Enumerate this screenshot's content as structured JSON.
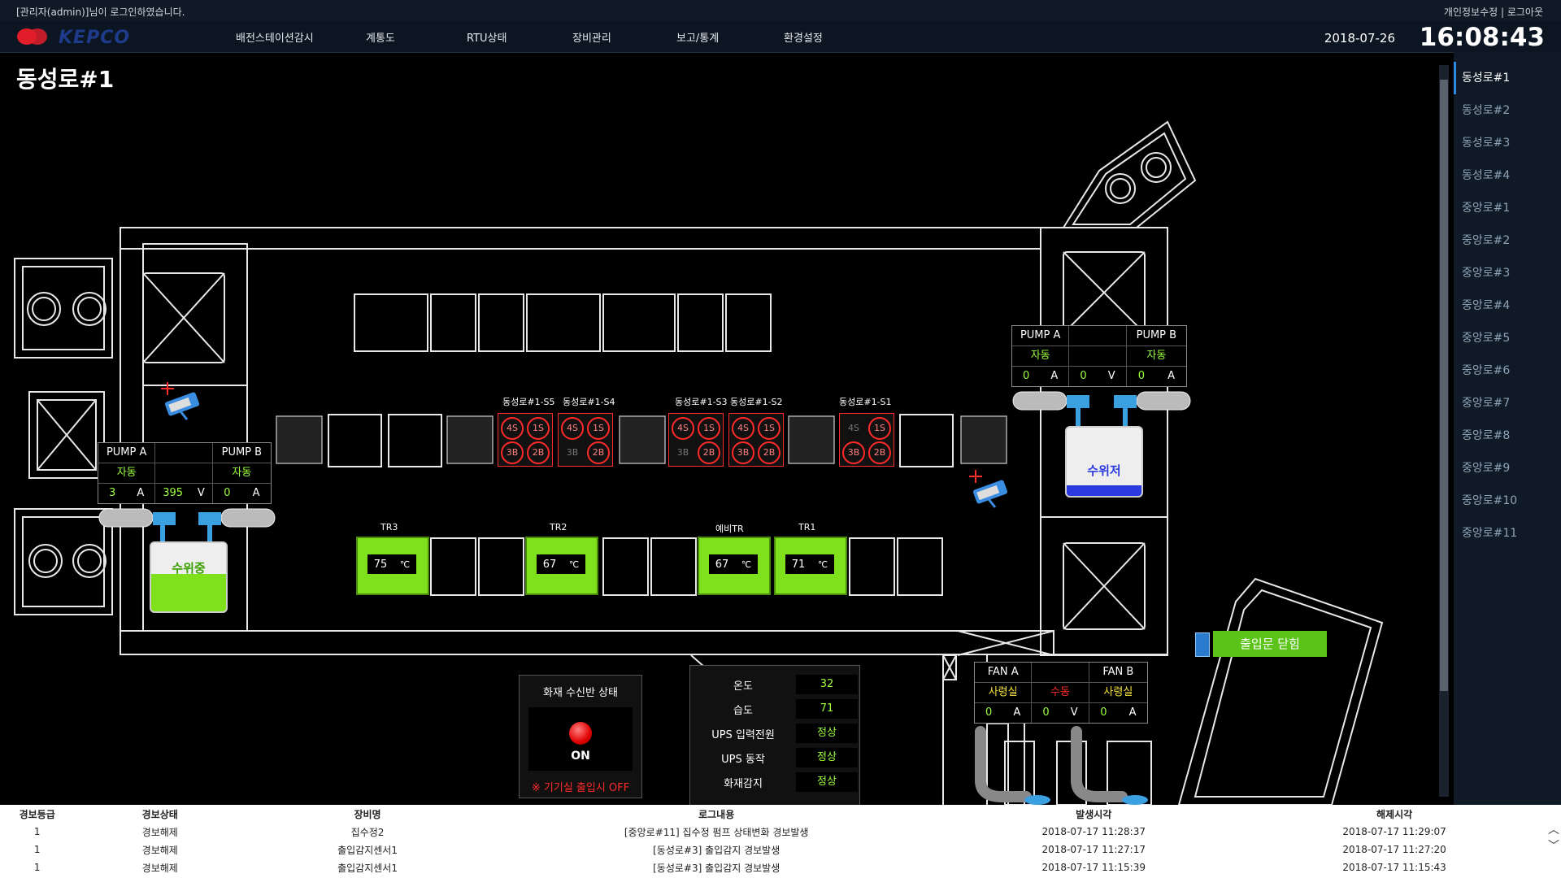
{
  "header": {
    "login_text": "[관리자(admin)]님이 로그인하였습니다.",
    "links": "개인정보수정 | 로그아웃",
    "logo": "KEPCO",
    "menu": [
      "배전스테이션감시",
      "계통도",
      "RTU상태",
      "장비관리",
      "보고/통계",
      "환경설정"
    ],
    "date": "2018-07-26",
    "time": "16:08:43"
  },
  "page": {
    "title": "동성로#1"
  },
  "sidebar": {
    "items": [
      "동성로#1",
      "동성로#2",
      "동성로#3",
      "동성로#4",
      "중앙로#1",
      "중앙로#2",
      "중앙로#3",
      "중앙로#4",
      "중앙로#5",
      "중앙로#6",
      "중앙로#7",
      "중앙로#8",
      "중앙로#9",
      "중앙로#10",
      "중앙로#11"
    ],
    "active": "동성로#1"
  },
  "pump_left": {
    "pump_a": "PUMP A",
    "pump_b": "PUMP B",
    "mode_a": "자동",
    "mode_b": "자동",
    "current_a": "3",
    "unit_a": "A",
    "voltage": "395",
    "unit_v": "V",
    "current_b": "0",
    "unit_b": "A",
    "tank_label": "수위중",
    "tank_level": 0.55
  },
  "pump_right": {
    "pump_a": "PUMP A",
    "pump_b": "PUMP B",
    "mode_a": "자동",
    "mode_b": "자동",
    "current_a": "0",
    "unit_a": "A",
    "voltage": "0",
    "unit_v": "V",
    "current_b": "0",
    "unit_b": "A",
    "tank_label": "수위저",
    "tank_level": 0.15
  },
  "switchgear": [
    {
      "label": "동성로#1-S5",
      "s4": "4S",
      "s1": "1S",
      "s3": "3B",
      "s2": "2B"
    },
    {
      "label": "동성로#1-S4",
      "s4": "4S",
      "s1": "1S",
      "s3": "3B",
      "s2": "2B"
    },
    {
      "label": "동성로#1-S3",
      "s4": "4S",
      "s1": "1S",
      "s3": "3B",
      "s2": "2B"
    },
    {
      "label": "동성로#1-S2",
      "s4": "4S",
      "s1": "1S",
      "s3": "3B",
      "s2": "2B"
    },
    {
      "label": "동성로#1-S1",
      "s4": "4S",
      "s1": "1S",
      "s3": "3B",
      "s2": "2B"
    }
  ],
  "transformers": [
    {
      "label": "TR3",
      "value": "75",
      "unit": "℃"
    },
    {
      "label": "TR2",
      "value": "67",
      "unit": "℃"
    },
    {
      "label": "예비TR",
      "value": "67",
      "unit": "℃"
    },
    {
      "label": "TR1",
      "value": "71",
      "unit": "℃"
    }
  ],
  "fire_panel": {
    "title": "화재 수신반 상태",
    "state": "ON",
    "note": "※ 기기실 출입시 OFF"
  },
  "env": {
    "rows": [
      {
        "label": "온도",
        "value": "32"
      },
      {
        "label": "습도",
        "value": "71"
      },
      {
        "label": "UPS 입력전원",
        "value": "정상"
      },
      {
        "label": "UPS 동작",
        "value": "정상"
      },
      {
        "label": "화재감지",
        "value": "정상"
      }
    ]
  },
  "fan": {
    "fan_a": "FAN A",
    "fan_b": "FAN B",
    "mode_a": "사령실",
    "mode_mid": "수동",
    "mode_b": "사령실",
    "current_a": "0",
    "unit_a": "A",
    "voltage": "0",
    "unit_v": "V",
    "current_b": "0",
    "unit_b": "A"
  },
  "door": {
    "label": "출입문 닫힘"
  },
  "alarm_table": {
    "headers": [
      "경보등급",
      "경보상태",
      "장비명",
      "로그내용",
      "발생시각",
      "해제시각"
    ],
    "rows": [
      {
        "grade": "1",
        "state": "경보해제",
        "device": "집수정2",
        "log": "[중앙로#11] 집수정 펌프 상태변화 경보발생",
        "start": "2018-07-17 11:28:37",
        "end": "2018-07-17 11:29:07"
      },
      {
        "grade": "1",
        "state": "경보해제",
        "device": "출입감지센서1",
        "log": "[동성로#3] 출입감지 경보발생",
        "start": "2018-07-17 11:27:17",
        "end": "2018-07-17 11:27:20"
      },
      {
        "grade": "1",
        "state": "경보해제",
        "device": "출입감지센서1",
        "log": "[동성로#3] 출입감지 경보발생",
        "start": "2018-07-17 11:15:39",
        "end": "2018-07-17 11:15:43"
      }
    ]
  },
  "colors": {
    "accent_green": "#7fe01c",
    "alarm_red": "#ff2a2a",
    "value_green": "#9cff3c",
    "text_yellow": "#f5e13a"
  }
}
